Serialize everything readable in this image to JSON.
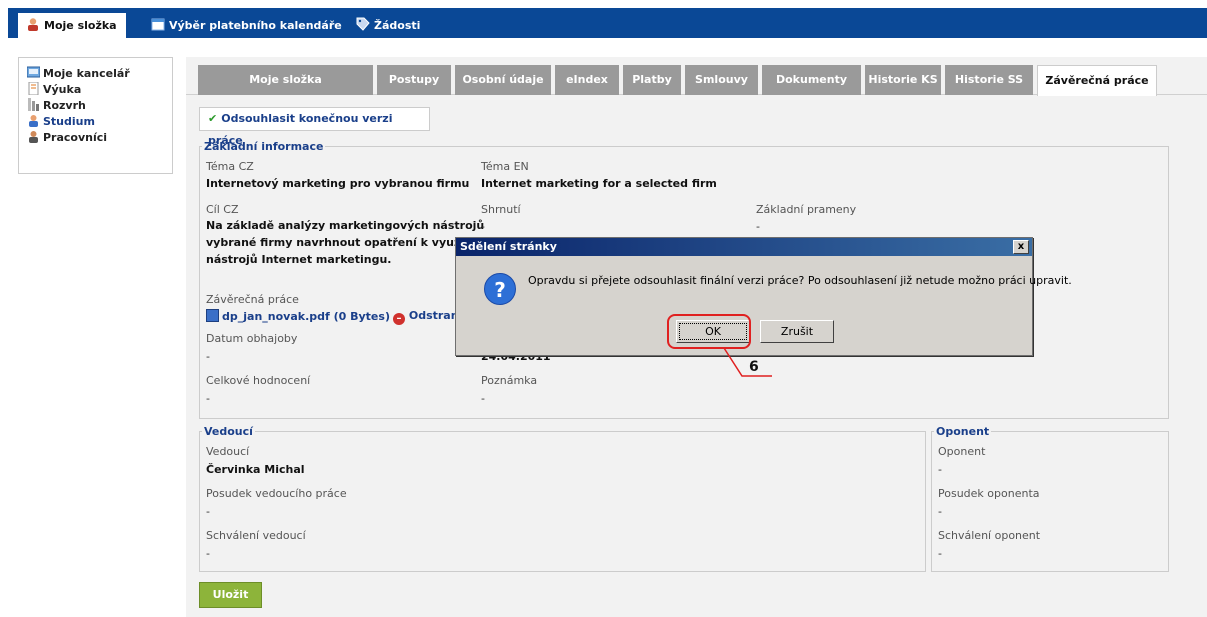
{
  "topnav": {
    "tabs": [
      {
        "label": "Moje složka",
        "icon": "user-icon"
      },
      {
        "label": "Výběr platebního kalendáře",
        "icon": "calendar-icon"
      },
      {
        "label": "Žádosti",
        "icon": "tag-icon"
      }
    ]
  },
  "sidebar": {
    "items": [
      {
        "label": "Moje kancelář",
        "icon": "office-icon"
      },
      {
        "label": "Výuka",
        "icon": "book-icon"
      },
      {
        "label": "Rozvrh",
        "icon": "schedule-icon"
      },
      {
        "label": "Studium",
        "icon": "student-icon"
      },
      {
        "label": "Pracovníci",
        "icon": "staff-icon"
      }
    ]
  },
  "tabs": [
    "Moje složka",
    "Postupy",
    "Osobní údaje",
    "eIndex",
    "Platby",
    "Smlouvy",
    "Dokumenty",
    "Historie KS",
    "Historie SS",
    "Závěrečná práce"
  ],
  "approve_button": "Odsouhlasit konečnou verzi práce",
  "basic": {
    "legend": "Základní informace",
    "tema_cz_label": "Téma CZ",
    "tema_cz": "Internetový marketing pro vybranou firmu",
    "tema_en_label": "Téma EN",
    "tema_en": "Internet marketing for a selected firm",
    "cil_label": "Cíl CZ",
    "cil_line1": "Na základě analýzy marketingových nástrojů",
    "cil_line2": "vybrané firmy navrhnout opatření k využití",
    "cil_line3": "nástrojů Internet marketingu.",
    "shrnuti_label": "Shrnutí",
    "shrnuti": "-",
    "prameny_label": "Základní prameny",
    "prameny": "-",
    "prace_label": "Závěrečná práce",
    "file": "dp_jan_novak.pdf (0 Bytes)",
    "remove": "Odstranit",
    "obhajoba_label": "Datum obhajoby",
    "obhajoba": "-",
    "date_partial": "24.04.2011",
    "hodnoceni_label": "Celkové hodnocení",
    "hodnoceni": "-",
    "poznamka_label": "Poznámka",
    "poznamka": "-"
  },
  "vedouci": {
    "legend": "Vedoucí",
    "label": "Vedoucí",
    "name": "Červinka Michal",
    "posudek_label": "Posudek vedoucího práce",
    "posudek": "-",
    "schvaleni_label": "Schválení vedoucí",
    "schvaleni": "-"
  },
  "oponent": {
    "legend": "Oponent",
    "label": "Oponent",
    "name": "-",
    "posudek_label": "Posudek oponenta",
    "posudek": "-",
    "schvaleni_label": "Schválení oponent",
    "schvaleni": "-"
  },
  "save_button": "Uložit",
  "dialog": {
    "title": "Sdělení stránky",
    "message": "Opravdu si přejete odsouhlasit finální verzi práce? Po odsouhlasení již netude možno práci upravit.",
    "ok": "OK",
    "cancel": "Zrušit",
    "close": "x"
  },
  "annotation": {
    "number": "6"
  }
}
